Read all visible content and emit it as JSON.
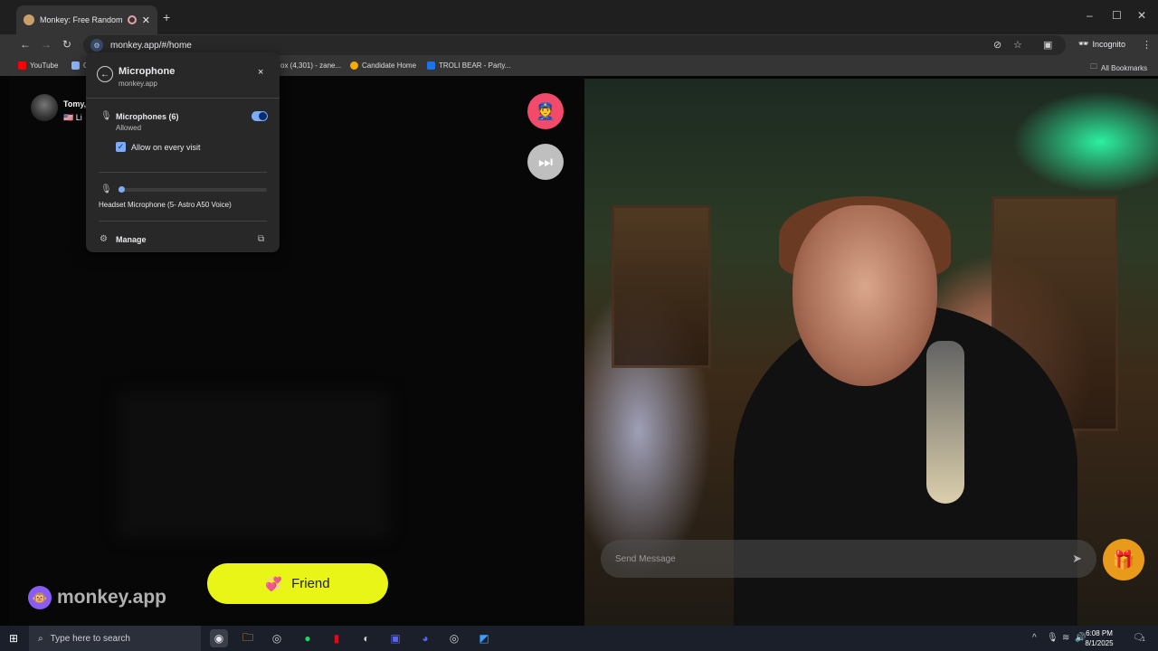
{
  "browser": {
    "tab_title": "Monkey: Free Random Vide",
    "new_tab": "+",
    "url": "monkey.app/#/home",
    "incognito_label": "Incognito",
    "window_controls": [
      "–",
      "☐",
      "✕"
    ],
    "bookmarks": [
      {
        "label": "YouTube",
        "color": "#ff0000"
      },
      {
        "label": "C",
        "color": "#8ab4f8"
      },
      {
        "label": "ox (4,301) - zane...",
        "color": "#dadce0"
      },
      {
        "label": "Candidate Home",
        "color": "#f9ab00"
      },
      {
        "label": "TROLI BEAR - Party...",
        "color": "#1a73e8"
      }
    ],
    "all_bookmarks": "All Bookmarks"
  },
  "popup": {
    "title": "Microphone",
    "subtitle": "monkey.app",
    "close": "×",
    "microphones_label": "Microphones (6)",
    "microphones_status": "Allowed",
    "toggle_on": true,
    "allow_label": "Allow on every visit",
    "allow_checked": true,
    "input_level": 0.02,
    "device_name": "Headset Microphone (5- Astro A50 Voice)",
    "manage_label": "Manage"
  },
  "page": {
    "user_name": "Tomy,",
    "user_flag": "🇺🇸 Li",
    "logo_text": "monkey.app",
    "friend_label": "Friend",
    "message_placeholder": "Send Message",
    "accent": "#e8f516",
    "report_color": "#f24a6a",
    "gift_color": "#e89a1a"
  },
  "taskbar": {
    "search_placeholder": "Type here to search",
    "time": "6:08 PM",
    "date": "8/1/2025",
    "notification_count": "1"
  }
}
